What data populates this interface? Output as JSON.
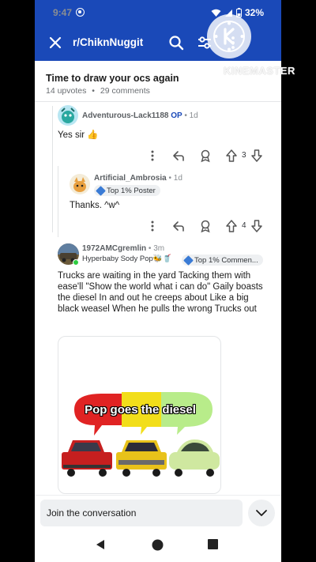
{
  "status": {
    "time": "9:47",
    "battery": "32%"
  },
  "appbar": {
    "subreddit": "r/ChiknNuggit"
  },
  "watermark": {
    "text": "KINEMASTER"
  },
  "post": {
    "title": "Time to draw your ocs again",
    "upvotes": "14 upvotes",
    "sep": "•",
    "comments": "29 comments"
  },
  "comments": [
    {
      "user": "Adventurous-Lack1188",
      "op": "OP",
      "time": "• 1d",
      "text": "Yes sir 👍",
      "score": "3"
    },
    {
      "user": "Artificial_Ambrosia",
      "time": "• 1d",
      "badge": "Top 1% Poster",
      "text": "Thanks. ^w^",
      "score": "4"
    },
    {
      "user": "1972AMCgremlin",
      "time": "• 3m",
      "flair": "Hyperbaby Sody Pop🐝🥤",
      "badge": "Top 1% Commen...",
      "text": "Trucks are waiting in the yard Tacking them with ease'll \"Show the world what i can do\" Gaily boasts the diesel In and out he creeps about Like a big black weasel When he pulls the wrong Trucks out",
      "image_caption": "Pop goes the diesel"
    }
  ],
  "joinbar": {
    "placeholder": "Join the conversation"
  },
  "colors": {
    "brand": "#1a49b8",
    "op": "#1a49b8"
  },
  "icons": [
    "close-icon",
    "search-icon",
    "filter-icon",
    "more-icon",
    "reply-icon",
    "award-icon",
    "upvote-icon",
    "downvote-icon",
    "chevron-down-icon",
    "back-icon",
    "home-icon",
    "recents-icon"
  ]
}
